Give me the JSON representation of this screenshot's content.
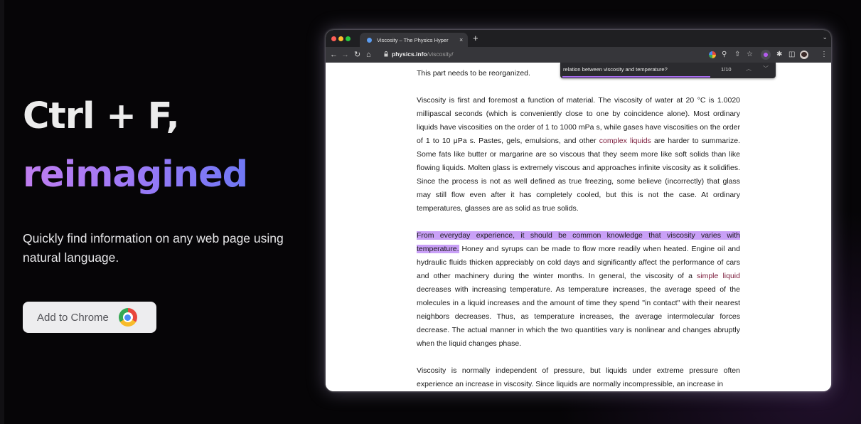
{
  "hero": {
    "title_line1": "Ctrl + F,",
    "title_line2": "reimagined",
    "subtitle": "Quickly find information on any web page using natural language.",
    "cta_label": "Add to Chrome",
    "cta_icon": "chrome-logo-icon"
  },
  "browser": {
    "tab_title": "Viscosity – The Physics Hyper",
    "tab_close": "×",
    "new_tab": "+",
    "url_host": "physics.info",
    "url_path": "/viscosity/",
    "find": {
      "query": "relation between viscosity and temperature?",
      "count": "1/10",
      "prev": "︿",
      "next": "﹀"
    }
  },
  "article": {
    "intro": "This part needs to be reorganized.",
    "p1_a": "Viscosity is first and foremost a function of material. The viscosity of water at 20 °C is 1.0020 millipascal seconds (which is conveniently close to one by coincidence alone). Most ordinary liquids have viscosities on the order of 1 to 1000 mPa s, while gases have viscosities on the order of 1 to 10 μPa s. Pastes, gels, emulsions, and other ",
    "p1_link": "complex liquids",
    "p1_b": " are harder to summarize. Some fats like butter or margarine are so viscous that they seem more like soft solids than like flowing liquids. Molten glass is extremely viscous and approaches infinite viscosity as it solidifies. Since the process is not as well defined as true freezing, some believe (incorrectly) that glass may still flow even after it has completely cooled, but this is not the case. At ordinary temperatures, glasses are as solid as true solids.",
    "p2_highlight": "From everyday experience, it should be common knowledge that viscosity varies with temperature.",
    "p2_a": " Honey and syrups can be made to flow more readily when heated. Engine oil and hydraulic fluids thicken appreciably on cold days and significantly affect the performance of cars and other machinery during the winter months. In general, the viscosity of a ",
    "p2_link": "simple liquid",
    "p2_b": " decreases with increasing temperature. As temperature increases, the average speed of the molecules in a liquid increases and the amount of time they spend \"in contact\" with their nearest neighbors decreases. Thus, as temperature increases, the average intermolecular forces decrease. The actual manner in which the two quantities vary is nonlinear and changes abruptly when the liquid changes phase.",
    "p3": "Viscosity is normally independent of pressure, but liquids under extreme pressure often experience an increase in viscosity. Since liquids are normally incompressible, an increase in"
  },
  "colors": {
    "accent_purple": "#a86cf0",
    "highlight": "#c9a0f7",
    "link": "#7a1a3a"
  }
}
